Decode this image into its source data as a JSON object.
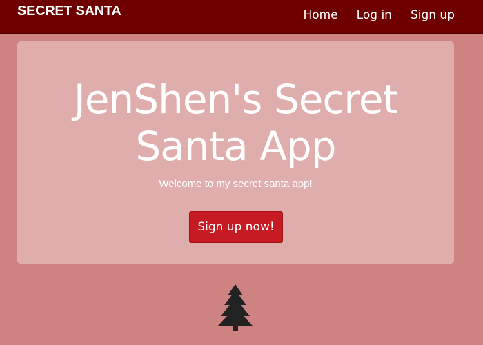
{
  "navbar": {
    "brand": "SECRET SANTA",
    "links": [
      {
        "label": "Home"
      },
      {
        "label": "Log in"
      },
      {
        "label": "Sign up"
      }
    ]
  },
  "hero": {
    "title_line1": "JenShen's Secret",
    "title_line2": "Santa App",
    "subtitle": "Welcome to my secret santa app!",
    "cta_label": "Sign up now!"
  },
  "footer": {
    "icon": "christmas-tree-icon"
  },
  "colors": {
    "page_background": "#cf8282",
    "navbar_background": "#6e0000",
    "jumbotron_background": "#dfadac",
    "button_background": "#c71b24",
    "tree_color": "#222222"
  }
}
